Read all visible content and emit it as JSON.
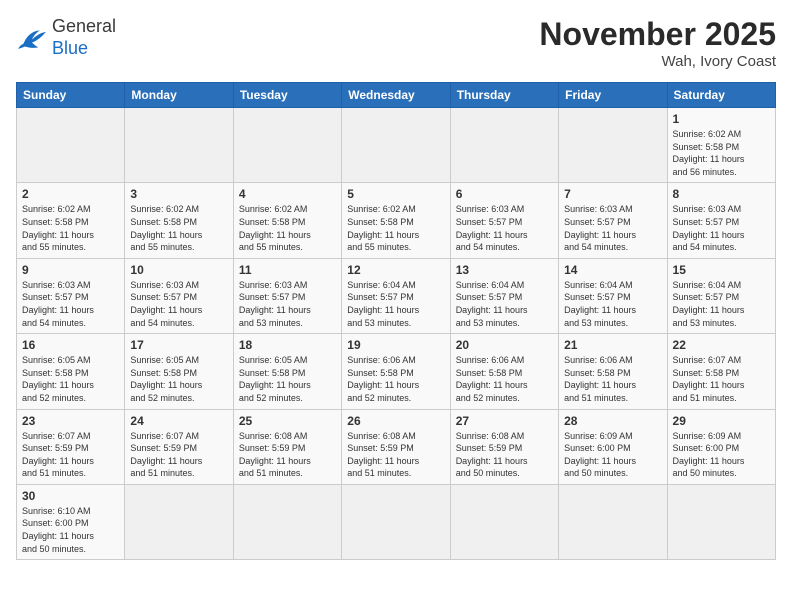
{
  "header": {
    "logo_general": "General",
    "logo_blue": "Blue",
    "month_title": "November 2025",
    "location": "Wah, Ivory Coast"
  },
  "weekdays": [
    "Sunday",
    "Monday",
    "Tuesday",
    "Wednesday",
    "Thursday",
    "Friday",
    "Saturday"
  ],
  "weeks": [
    [
      {
        "day": "",
        "info": ""
      },
      {
        "day": "",
        "info": ""
      },
      {
        "day": "",
        "info": ""
      },
      {
        "day": "",
        "info": ""
      },
      {
        "day": "",
        "info": ""
      },
      {
        "day": "",
        "info": ""
      },
      {
        "day": "1",
        "info": "Sunrise: 6:02 AM\nSunset: 5:58 PM\nDaylight: 11 hours\nand 56 minutes."
      }
    ],
    [
      {
        "day": "2",
        "info": "Sunrise: 6:02 AM\nSunset: 5:58 PM\nDaylight: 11 hours\nand 55 minutes."
      },
      {
        "day": "3",
        "info": "Sunrise: 6:02 AM\nSunset: 5:58 PM\nDaylight: 11 hours\nand 55 minutes."
      },
      {
        "day": "4",
        "info": "Sunrise: 6:02 AM\nSunset: 5:58 PM\nDaylight: 11 hours\nand 55 minutes."
      },
      {
        "day": "5",
        "info": "Sunrise: 6:02 AM\nSunset: 5:58 PM\nDaylight: 11 hours\nand 55 minutes."
      },
      {
        "day": "6",
        "info": "Sunrise: 6:03 AM\nSunset: 5:57 PM\nDaylight: 11 hours\nand 54 minutes."
      },
      {
        "day": "7",
        "info": "Sunrise: 6:03 AM\nSunset: 5:57 PM\nDaylight: 11 hours\nand 54 minutes."
      },
      {
        "day": "8",
        "info": "Sunrise: 6:03 AM\nSunset: 5:57 PM\nDaylight: 11 hours\nand 54 minutes."
      }
    ],
    [
      {
        "day": "9",
        "info": "Sunrise: 6:03 AM\nSunset: 5:57 PM\nDaylight: 11 hours\nand 54 minutes."
      },
      {
        "day": "10",
        "info": "Sunrise: 6:03 AM\nSunset: 5:57 PM\nDaylight: 11 hours\nand 54 minutes."
      },
      {
        "day": "11",
        "info": "Sunrise: 6:03 AM\nSunset: 5:57 PM\nDaylight: 11 hours\nand 53 minutes."
      },
      {
        "day": "12",
        "info": "Sunrise: 6:04 AM\nSunset: 5:57 PM\nDaylight: 11 hours\nand 53 minutes."
      },
      {
        "day": "13",
        "info": "Sunrise: 6:04 AM\nSunset: 5:57 PM\nDaylight: 11 hours\nand 53 minutes."
      },
      {
        "day": "14",
        "info": "Sunrise: 6:04 AM\nSunset: 5:57 PM\nDaylight: 11 hours\nand 53 minutes."
      },
      {
        "day": "15",
        "info": "Sunrise: 6:04 AM\nSunset: 5:57 PM\nDaylight: 11 hours\nand 53 minutes."
      }
    ],
    [
      {
        "day": "16",
        "info": "Sunrise: 6:05 AM\nSunset: 5:58 PM\nDaylight: 11 hours\nand 52 minutes."
      },
      {
        "day": "17",
        "info": "Sunrise: 6:05 AM\nSunset: 5:58 PM\nDaylight: 11 hours\nand 52 minutes."
      },
      {
        "day": "18",
        "info": "Sunrise: 6:05 AM\nSunset: 5:58 PM\nDaylight: 11 hours\nand 52 minutes."
      },
      {
        "day": "19",
        "info": "Sunrise: 6:06 AM\nSunset: 5:58 PM\nDaylight: 11 hours\nand 52 minutes."
      },
      {
        "day": "20",
        "info": "Sunrise: 6:06 AM\nSunset: 5:58 PM\nDaylight: 11 hours\nand 52 minutes."
      },
      {
        "day": "21",
        "info": "Sunrise: 6:06 AM\nSunset: 5:58 PM\nDaylight: 11 hours\nand 51 minutes."
      },
      {
        "day": "22",
        "info": "Sunrise: 6:07 AM\nSunset: 5:58 PM\nDaylight: 11 hours\nand 51 minutes."
      }
    ],
    [
      {
        "day": "23",
        "info": "Sunrise: 6:07 AM\nSunset: 5:59 PM\nDaylight: 11 hours\nand 51 minutes."
      },
      {
        "day": "24",
        "info": "Sunrise: 6:07 AM\nSunset: 5:59 PM\nDaylight: 11 hours\nand 51 minutes."
      },
      {
        "day": "25",
        "info": "Sunrise: 6:08 AM\nSunset: 5:59 PM\nDaylight: 11 hours\nand 51 minutes."
      },
      {
        "day": "26",
        "info": "Sunrise: 6:08 AM\nSunset: 5:59 PM\nDaylight: 11 hours\nand 51 minutes."
      },
      {
        "day": "27",
        "info": "Sunrise: 6:08 AM\nSunset: 5:59 PM\nDaylight: 11 hours\nand 50 minutes."
      },
      {
        "day": "28",
        "info": "Sunrise: 6:09 AM\nSunset: 6:00 PM\nDaylight: 11 hours\nand 50 minutes."
      },
      {
        "day": "29",
        "info": "Sunrise: 6:09 AM\nSunset: 6:00 PM\nDaylight: 11 hours\nand 50 minutes."
      }
    ],
    [
      {
        "day": "30",
        "info": "Sunrise: 6:10 AM\nSunset: 6:00 PM\nDaylight: 11 hours\nand 50 minutes."
      },
      {
        "day": "",
        "info": ""
      },
      {
        "day": "",
        "info": ""
      },
      {
        "day": "",
        "info": ""
      },
      {
        "day": "",
        "info": ""
      },
      {
        "day": "",
        "info": ""
      },
      {
        "day": "",
        "info": ""
      }
    ]
  ]
}
